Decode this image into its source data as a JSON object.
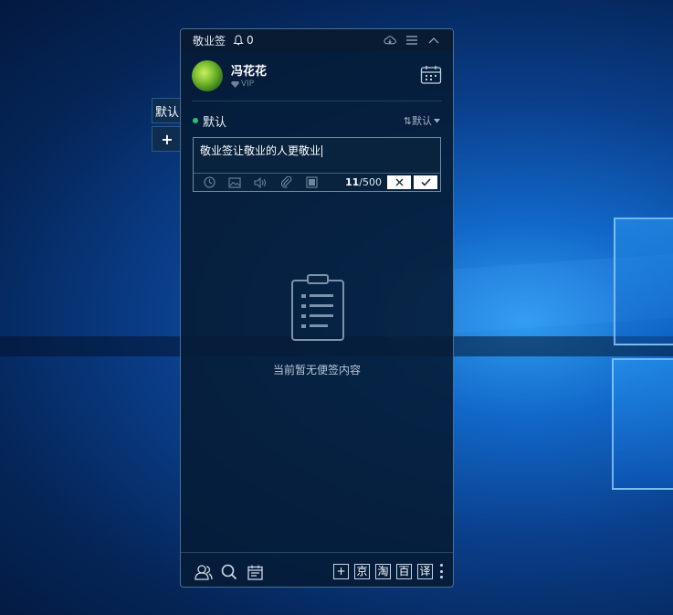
{
  "app": {
    "title": "敬业签",
    "notification_count": "0"
  },
  "side_tabs": {
    "default_label": "默认",
    "add_label": "+"
  },
  "user": {
    "name": "冯花花",
    "level": "VIP"
  },
  "group": {
    "name": "默认",
    "sort_label": "⇅默认"
  },
  "editor": {
    "text": "敬业签让敬业的人更敬业",
    "char_count": "11",
    "char_limit": "/500"
  },
  "empty_state": {
    "message": "当前暂无便签内容"
  },
  "footer": {
    "shortcuts": [
      "+",
      "京",
      "淘",
      "百",
      "译"
    ]
  },
  "colors": {
    "panel_bg": "#061c36",
    "accent_green": "#2fbe72",
    "desktop_blue": "#1167c8"
  }
}
